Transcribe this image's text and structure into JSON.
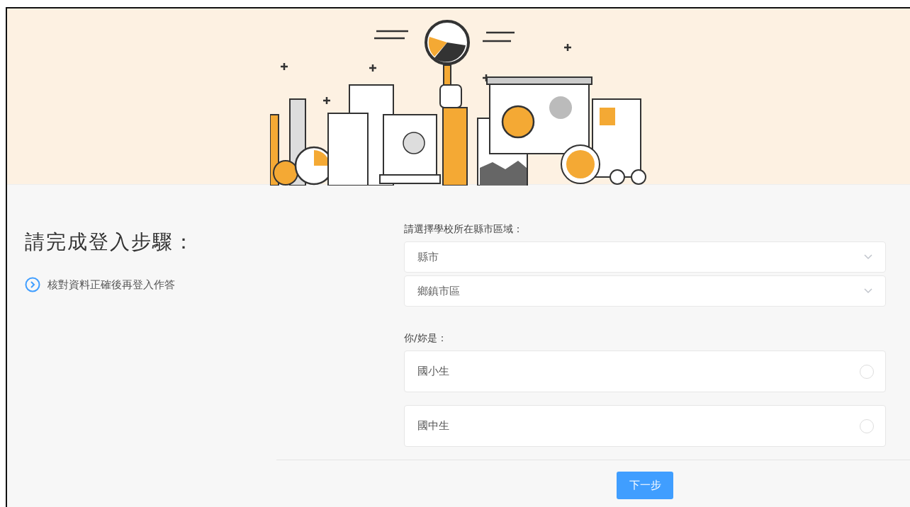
{
  "heading": "請完成登入步驟：",
  "hint": "核對資料正確後再登入作答",
  "region": {
    "label": "請選擇學校所在縣市區域：",
    "selects": [
      {
        "placeholder": "縣市"
      },
      {
        "placeholder": "鄉鎮市區"
      }
    ]
  },
  "role": {
    "label": "你/妳是：",
    "options": [
      {
        "label": "國小生",
        "selected": false
      },
      {
        "label": "國中生",
        "selected": false
      }
    ]
  },
  "next_button": "下一步"
}
